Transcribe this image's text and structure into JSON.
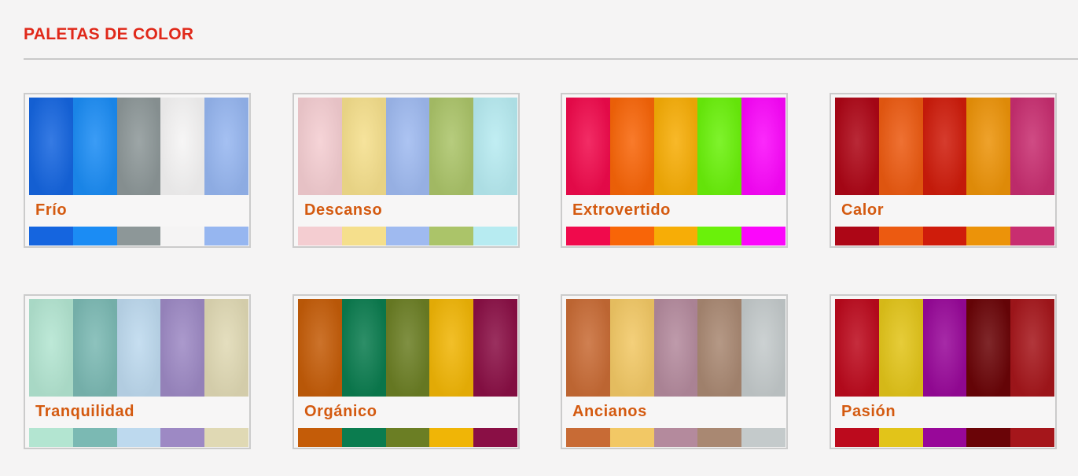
{
  "header": {
    "title": "PALETAS DE COLOR"
  },
  "palettes": [
    {
      "name": "Frío",
      "colors": [
        "#1565df",
        "#1b8cf4",
        "#8d9798",
        "#f5f4f4",
        "#96b6f0"
      ]
    },
    {
      "name": "Descanso",
      "colors": [
        "#f4cdd1",
        "#f5df8c",
        "#9fbaf0",
        "#abc469",
        "#b7ebf1"
      ]
    },
    {
      "name": "Extrovertido",
      "colors": [
        "#f00a4c",
        "#f86508",
        "#f7ad06",
        "#6af10a",
        "#fb07fb"
      ]
    },
    {
      "name": "Calor",
      "colors": [
        "#ad0616",
        "#ec5a11",
        "#cf1c0b",
        "#ec9309",
        "#c82e70"
      ]
    },
    {
      "name": "Tranquilidad",
      "colors": [
        "#b3e5d1",
        "#7bb9b3",
        "#bdd9ee",
        "#9d89c4",
        "#e0d9b4"
      ]
    },
    {
      "name": "Orgánico",
      "colors": [
        "#c45c08",
        "#0b7c4f",
        "#6b7e24",
        "#f0b506",
        "#8a0f45"
      ]
    },
    {
      "name": "Ancianos",
      "colors": [
        "#c86b35",
        "#f2c865",
        "#b48a9d",
        "#a98872",
        "#c4cacb"
      ]
    },
    {
      "name": "Pasión",
      "colors": [
        "#bc0a1d",
        "#e2c419",
        "#980899",
        "#6a0407",
        "#a5161b"
      ]
    }
  ]
}
